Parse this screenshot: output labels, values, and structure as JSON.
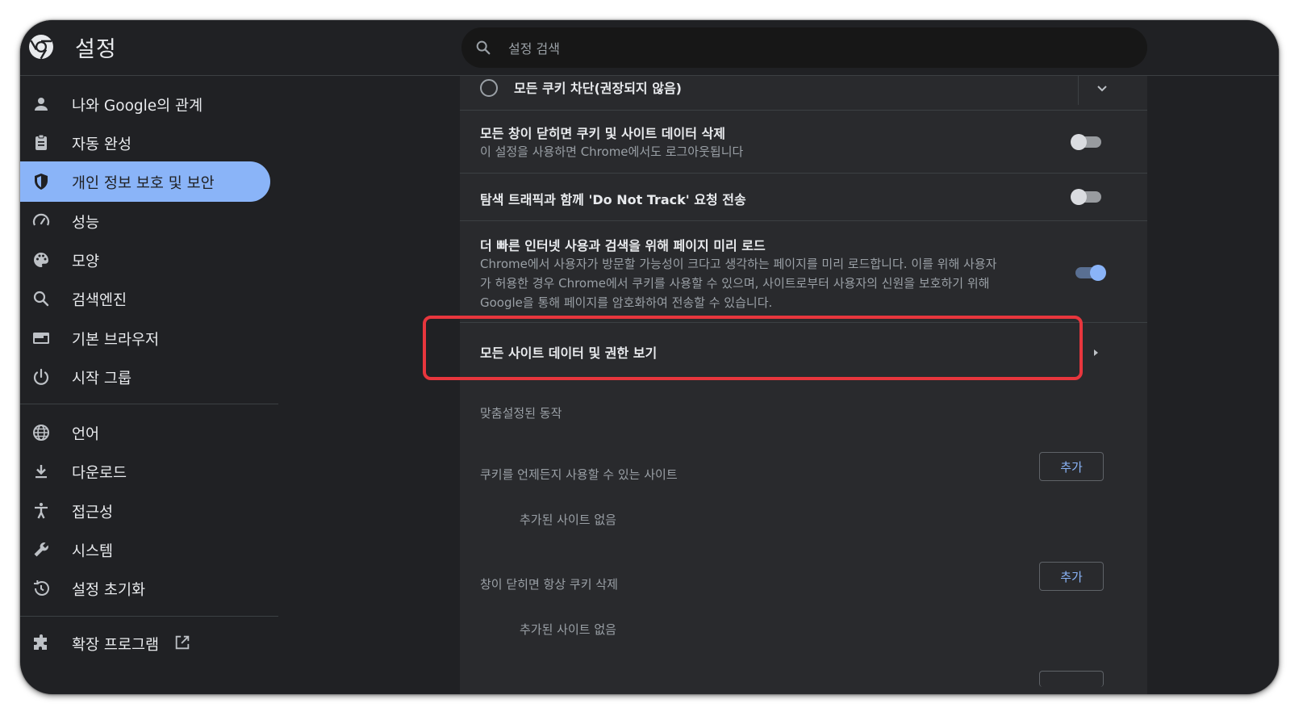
{
  "header": {
    "title": "설정",
    "search_placeholder": "설정 검색"
  },
  "sidebar": {
    "items": [
      {
        "label": "나와 Google의 관계",
        "icon": "person-icon"
      },
      {
        "label": "자동 완성",
        "icon": "clipboard-icon"
      },
      {
        "label": "개인 정보 보호 및 보안",
        "icon": "shield-icon",
        "active": true
      },
      {
        "label": "성능",
        "icon": "speedometer-icon"
      },
      {
        "label": "모양",
        "icon": "palette-icon"
      },
      {
        "label": "검색엔진",
        "icon": "search-icon"
      },
      {
        "label": "기본 브라우저",
        "icon": "browser-icon"
      },
      {
        "label": "시작 그룹",
        "icon": "power-icon"
      },
      {
        "label": "언어",
        "icon": "globe-icon"
      },
      {
        "label": "다운로드",
        "icon": "download-icon"
      },
      {
        "label": "접근성",
        "icon": "accessibility-icon"
      },
      {
        "label": "시스템",
        "icon": "wrench-icon"
      },
      {
        "label": "설정 초기화",
        "icon": "history-icon"
      },
      {
        "label": "확장 프로그램",
        "icon": "puzzle-icon"
      }
    ]
  },
  "main": {
    "block_all_cookies": {
      "label": "모든 쿠키 차단(권장되지 않음)"
    },
    "clear_on_exit": {
      "title": "모든 창이 닫히면 쿠키 및 사이트 데이터 삭제",
      "description": "이 설정을 사용하면 Chrome에서도 로그아웃됩니다",
      "enabled": false
    },
    "do_not_track": {
      "title": "탐색 트래픽과 함께 'Do Not Track' 요청 전송",
      "enabled": false
    },
    "preload": {
      "title": "더 빠른 인터넷 사용과 검색을 위해 페이지 미리 로드",
      "description_lines": [
        "Chrome에서 사용자가 방문할 가능성이 크다고 생각하는 페이지를 미리 로드합니다. 이를 위해 사용자",
        "가 허용한 경우 Chrome에서 쿠키를 사용할 수 있으며, 사이트로부터 사용자의 신원을 보호하기 위해",
        "Google을 통해 페이지를 암호화하여 전송할 수 있습니다."
      ],
      "enabled": true
    },
    "site_data": {
      "label": "모든 사이트 데이터 및 권한 보기"
    },
    "custom_behaviors": {
      "heading": "맞춤설정된 동작",
      "lists": [
        {
          "label": "쿠키를 언제든지 사용할 수 있는 사이트",
          "add_label": "추가",
          "empty_text": "추가된 사이트 없음"
        },
        {
          "label": "창이 닫히면 항상 쿠키 삭제",
          "add_label": "추가",
          "empty_text": "추가된 사이트 없음"
        }
      ]
    }
  },
  "colors": {
    "background": "#202124",
    "card": "#292a2d",
    "accent": "#8ab4f8",
    "highlight": "#e8363d"
  }
}
